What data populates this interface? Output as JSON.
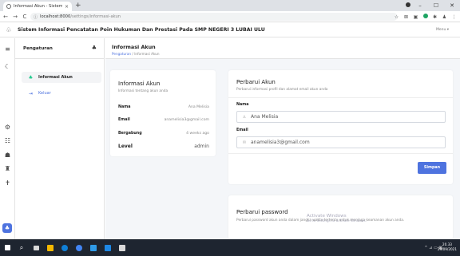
{
  "browser": {
    "tab_title": "Informasi Akun - Sistem Informa",
    "tab_close": "×",
    "new_tab": "+",
    "window_controls": {
      "minimize": "–",
      "maximize": "☐",
      "close": "✕"
    },
    "nav": {
      "back": "←",
      "forward": "→",
      "reload": "C"
    },
    "url_host": "localhost:8000",
    "url_path": "/settings/informasi-akun",
    "info_icon": "ⓘ",
    "extensions": {
      "star": "☆",
      "ext1": "⊠",
      "ext2": "▣",
      "ext3": "✱",
      "ext4": "♟",
      "menu": "⋮"
    }
  },
  "app": {
    "logo_icon": "♧",
    "title": "Sistem Informasi Pencatatan Poin Hukuman Dan Prestasi Pada SMP NEGERI 3 LUBAI ULU",
    "user_menu": "Menu ▾"
  },
  "rail": {
    "hamburger": "≡",
    "moon": "☾",
    "icons": [
      "⚙",
      "☷",
      "☗",
      "♜",
      "✝"
    ],
    "active": "♣"
  },
  "sidebar": {
    "title": "Pengaturan",
    "title_icon": "♣",
    "items": [
      {
        "icon": "♣",
        "label": "Informasi Akun"
      },
      {
        "icon": "⇥",
        "label": "Keluar"
      }
    ]
  },
  "main": {
    "page_title": "Informasi Akun",
    "breadcrumb_link": "Pengaturan",
    "breadcrumb_sep": "/",
    "breadcrumb_current": "Informasi Akun"
  },
  "info_card": {
    "title": "Informasi Akun",
    "subtitle": "Informasi tentang akun anda",
    "rows": [
      {
        "label": "Nama",
        "value": "Ana Melisia"
      },
      {
        "label": "Email",
        "value": "anamelisia3@gmail.com"
      },
      {
        "label": "Bergabung",
        "value": "4 weeks ago"
      },
      {
        "label": "Level",
        "value": "admin"
      }
    ]
  },
  "update_card": {
    "title": "Perbarui Akun",
    "subtitle": "Perbarui informasi profil dan alamat email akun anda",
    "name_label": "Nama",
    "name_icon": "♙",
    "name_value": "Ana Melisia",
    "email_label": "Email",
    "email_icon": "✉",
    "email_value": "anamelisia3@gmail.com",
    "save_label": "Simpan"
  },
  "password_card": {
    "title": "Perbarui password",
    "subtitle": "Perbarui password akun anda dalam jangka waktu tertentu untuk menjaga keamanan akun anda."
  },
  "watermark": {
    "line1": "Activate Windows",
    "line2": "Go to Settings to activate Windows."
  },
  "taskbar": {
    "search_icon": "⌕",
    "tray_icons": "^ ⊿ ▭ ▦",
    "time": "20.33",
    "date": "29/09/2021"
  },
  "colors": {
    "primary": "#4e73df",
    "success": "#1cc88a",
    "taskbar": "#1e2530",
    "chrome_tab": "#4285f4",
    "edge": "#0f7fd6",
    "explorer": "#f5b800",
    "store": "#2f9be8",
    "vscode": "#1e88e5",
    "terminal": "#d9d9d9"
  }
}
